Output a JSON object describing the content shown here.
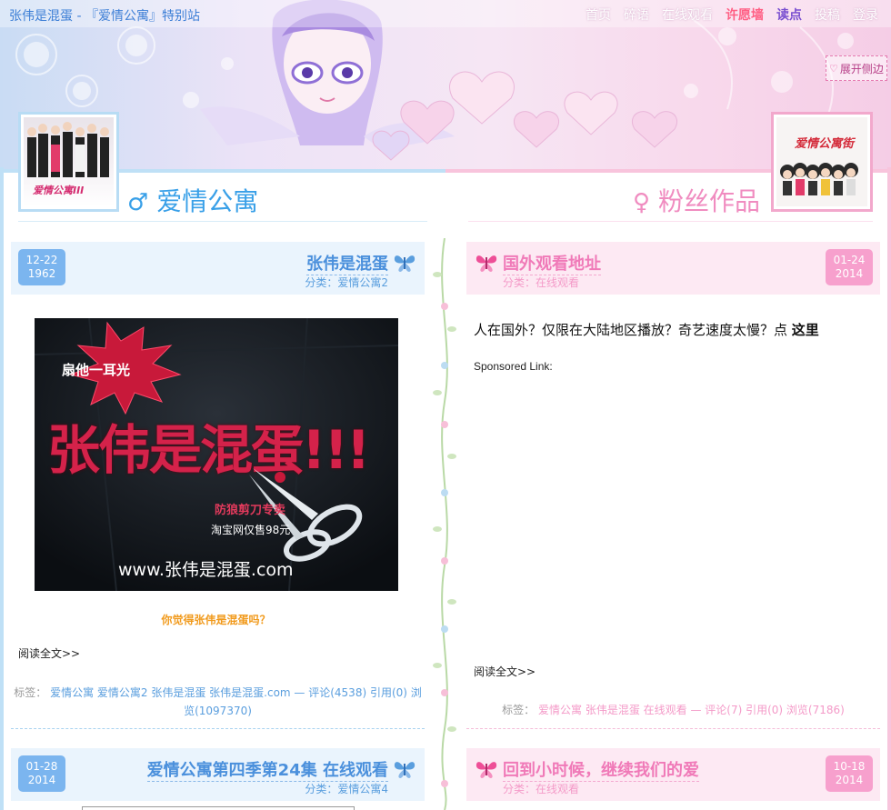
{
  "site": {
    "title": "张伟是混蛋 - 『爱情公寓』特别站"
  },
  "nav": {
    "items": [
      "首页",
      "碎语",
      "在线观看",
      "许愿墙",
      "读点",
      "投稿",
      "登录"
    ]
  },
  "sidebar_toggle": {
    "label": "展开侧边"
  },
  "categories": {
    "left": "爱情公寓",
    "right": "粉丝作品",
    "left_symbol": "♂",
    "right_symbol": "♀"
  },
  "posters": {
    "left_text": "爱情公寓III",
    "right_text": "爱情公寓街"
  },
  "posts_left": [
    {
      "date_md": "12-22",
      "date_y": "1962",
      "title": "张伟是混蛋",
      "category": "分类：爱情公寓2",
      "image": {
        "burst": "扇他一耳光",
        "headline": "张伟是混蛋!!!",
        "promo1": "防狼剪刀专卖",
        "promo2": "淘宝网仅售98元",
        "url": "www.张伟是混蛋.com"
      },
      "caption": "你觉得张伟是混蛋吗？",
      "read_more": "阅读全文>>",
      "tags_label": "标签：",
      "tags_text": "爱情公寓 爱情公寓2 张伟是混蛋 张伟是混蛋.com — 评论(4538) 引用(0) 浏览(1097370)"
    },
    {
      "date_md": "01-28",
      "date_y": "2014",
      "title": "爱情公寓第四季第24集 在线观看",
      "category": "分类：爱情公寓4"
    }
  ],
  "posts_right": [
    {
      "date_md": "01-24",
      "date_y": "2014",
      "title": "国外观看地址",
      "category": "分类：在线观看",
      "body_prefix": "人在国外？仅限在大陆地区播放？奇艺速度太慢？点 ",
      "body_link": "这里",
      "sponsored": "Sponsored Link:",
      "read_more": "阅读全文>>",
      "tags_label": "标签：",
      "tags_text": "爱情公寓 张伟是混蛋 在线观看 — 评论(7) 引用(0) 浏览(7186)"
    },
    {
      "date_md": "10-18",
      "date_y": "2014",
      "title": "回到小时候，继续我们的爱",
      "category": "分类：在线观看"
    }
  ],
  "colors": {
    "blue_accent": "#4b90dc",
    "pink_accent": "#f07ab8",
    "caption_orange": "#f19a1c",
    "nav_red": "#ff5f84",
    "nav_purple": "#7a4fd0"
  }
}
